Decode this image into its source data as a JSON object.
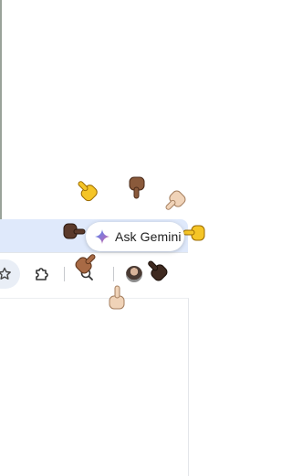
{
  "gemini_chip": {
    "label": "Ask Gemini",
    "icon": "gemini-sparkle-icon"
  },
  "toolbar": {
    "icons": [
      "bookmark-star-icon",
      "extensions-puzzle-icon",
      "zoom-icon",
      "profile-avatar"
    ]
  },
  "decorations": {
    "pointing_hands": [
      {
        "skin": "#f5c527",
        "direction": "down-right"
      },
      {
        "skin": "#8a5a3b",
        "direction": "down"
      },
      {
        "skin": "#f0d3b8",
        "direction": "down-left"
      },
      {
        "skin": "#f5c527",
        "direction": "left"
      },
      {
        "skin": "#5b3a2b",
        "direction": "right"
      },
      {
        "skin": "#a86a45",
        "direction": "up-right"
      },
      {
        "skin": "#3f2a20",
        "direction": "up-left"
      },
      {
        "skin": "#f0d3b8",
        "direction": "up"
      }
    ]
  },
  "colors": {
    "tab_strip": "#dfe9fb",
    "omnibox": "#e9eef6",
    "gemini_blue": "#4b8bf5"
  }
}
